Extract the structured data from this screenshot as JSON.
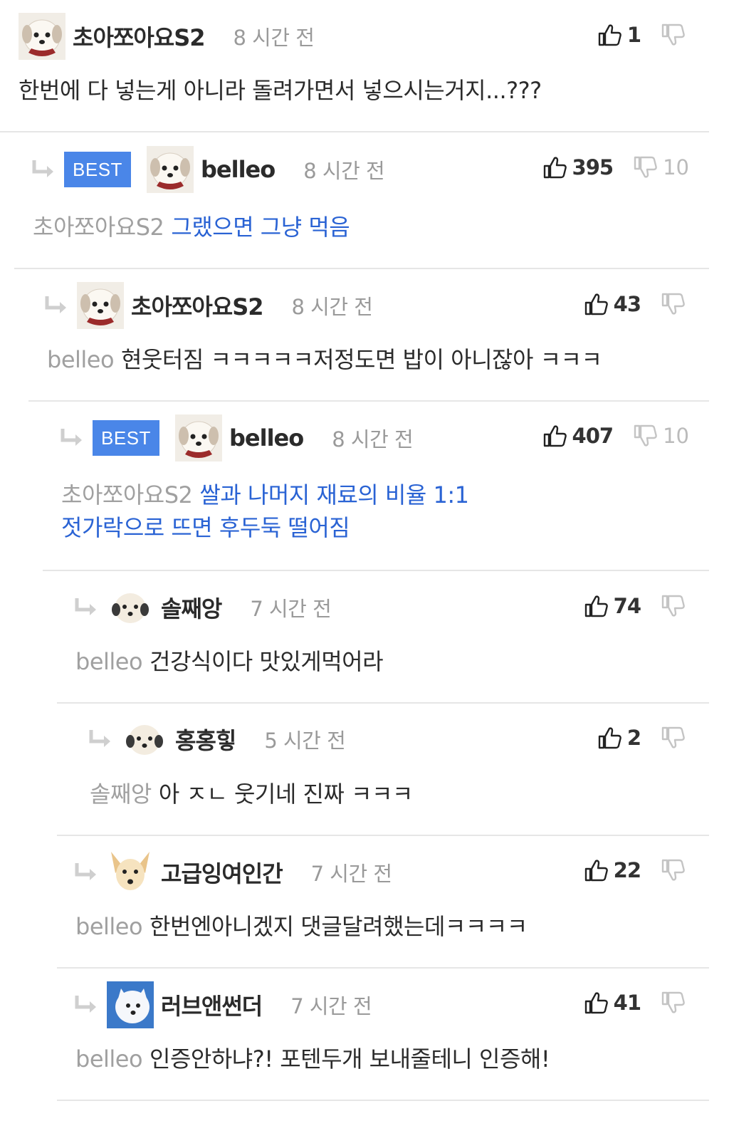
{
  "comments": [
    {
      "author": "초아쪼아요S2",
      "time": "8 시간 전",
      "up": "1",
      "down": "",
      "best": "",
      "mention": "",
      "text": "한번에 다 넣는게 아니라 돌려가면서 넣으시는거지...???"
    },
    {
      "author": "belleo",
      "time": "8 시간 전",
      "up": "395",
      "down": "10",
      "best": "BEST",
      "mention": "초아쪼아요S2",
      "text": "그랬으면 그냥 먹음"
    },
    {
      "author": "초아쪼아요S2",
      "time": "8 시간 전",
      "up": "43",
      "down": "",
      "best": "",
      "mention": "belleo",
      "text": "현웃터짐 ㅋㅋㅋㅋㅋ저정도면 밥이 아니잖아 ㅋㅋㅋ"
    },
    {
      "author": "belleo",
      "time": "8 시간 전",
      "up": "407",
      "down": "10",
      "best": "BEST",
      "mention": "초아쪼아요S2",
      "text": "쌀과 나머지 재료의 비율 1:1",
      "text2": "젓가락으로 뜨면 후두둑 떨어짐"
    },
    {
      "author": "솔째앙",
      "time": "7 시간 전",
      "up": "74",
      "down": "",
      "best": "",
      "mention": "belleo",
      "text": "건강식이다 맛있게먹어라"
    },
    {
      "author": "홍홍힣",
      "time": "5 시간 전",
      "up": "2",
      "down": "",
      "best": "",
      "mention": "솔째앙",
      "text": "아 ㅈㄴ 웃기네 진짜 ㅋㅋㅋ"
    },
    {
      "author": "고급잉여인간",
      "time": "7 시간 전",
      "up": "22",
      "down": "",
      "best": "",
      "mention": "belleo",
      "text": "한번엔아니겠지 댓글달려했는데ㅋㅋㅋㅋ"
    },
    {
      "author": "러브앤썬더",
      "time": "7 시간 전",
      "up": "41",
      "down": "",
      "best": "",
      "mention": "belleo",
      "text": "인증안하냐?! 포텐두개 보내줄테니 인증해!"
    }
  ],
  "icons": {
    "upvote": "thumbs-up-icon",
    "downvote": "thumbs-down-icon",
    "reply": "reply-arrow-icon"
  },
  "colors": {
    "best_badge": "#4a86e8",
    "best_text": "#2a63d4",
    "mention": "#a0a0a0",
    "divider": "#e6e6e6"
  }
}
